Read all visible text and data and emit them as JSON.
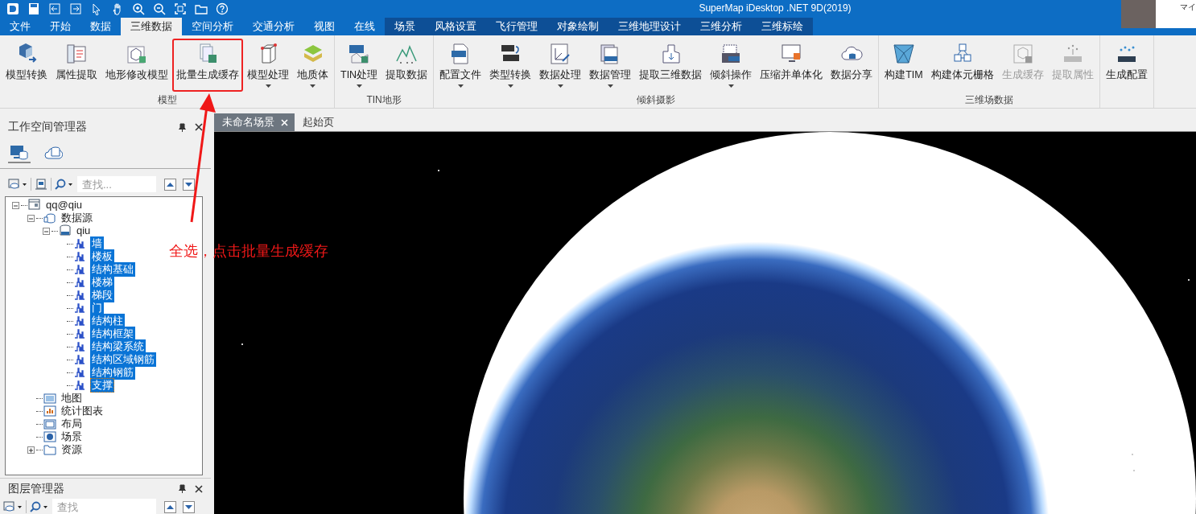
{
  "window": {
    "title": "SuperMap iDesktop .NET 9D(2019)",
    "user_label": "マイ"
  },
  "menu_tabs": [
    {
      "label": "文件",
      "selected": false,
      "kind": "main"
    },
    {
      "label": "开始",
      "selected": false,
      "kind": "main"
    },
    {
      "label": "数据",
      "selected": false,
      "kind": "main"
    },
    {
      "label": "三维数据",
      "selected": true,
      "kind": "main"
    },
    {
      "label": "空间分析",
      "selected": false,
      "kind": "main"
    },
    {
      "label": "交通分析",
      "selected": false,
      "kind": "main"
    },
    {
      "label": "视图",
      "selected": false,
      "kind": "main"
    },
    {
      "label": "在线",
      "selected": false,
      "kind": "main"
    },
    {
      "label": "场景",
      "selected": false,
      "kind": "context"
    },
    {
      "label": "风格设置",
      "selected": false,
      "kind": "context"
    },
    {
      "label": "飞行管理",
      "selected": false,
      "kind": "context"
    },
    {
      "label": "对象绘制",
      "selected": false,
      "kind": "context"
    },
    {
      "label": "三维地理设计",
      "selected": false,
      "kind": "context"
    },
    {
      "label": "三维分析",
      "selected": false,
      "kind": "context"
    },
    {
      "label": "三维标绘",
      "selected": false,
      "kind": "context"
    }
  ],
  "ribbon": {
    "groups": [
      {
        "label": "模型",
        "buttons": [
          {
            "label": "模型转换",
            "dropdown": false,
            "disabled": false,
            "highlighted": false
          },
          {
            "label": "属性提取",
            "dropdown": false,
            "disabled": false,
            "highlighted": false
          },
          {
            "label": "地形修改模型",
            "dropdown": false,
            "disabled": false,
            "highlighted": false
          },
          {
            "label": "批量生成缓存",
            "dropdown": false,
            "disabled": false,
            "highlighted": true
          },
          {
            "label": "模型处理",
            "dropdown": true,
            "disabled": false,
            "highlighted": false
          },
          {
            "label": "地质体",
            "dropdown": true,
            "disabled": false,
            "highlighted": false
          }
        ]
      },
      {
        "label": "TIN地形",
        "buttons": [
          {
            "label": "TIN处理",
            "dropdown": true,
            "disabled": false,
            "highlighted": false
          },
          {
            "label": "提取数据",
            "dropdown": false,
            "disabled": false,
            "highlighted": false
          }
        ]
      },
      {
        "label": "倾斜摄影",
        "buttons": [
          {
            "label": "配置文件",
            "dropdown": true,
            "disabled": false,
            "highlighted": false
          },
          {
            "label": "类型转换",
            "dropdown": true,
            "disabled": false,
            "highlighted": false
          },
          {
            "label": "数据处理",
            "dropdown": true,
            "disabled": false,
            "highlighted": false
          },
          {
            "label": "数据管理",
            "dropdown": true,
            "disabled": false,
            "highlighted": false
          },
          {
            "label": "提取三维数据",
            "dropdown": false,
            "disabled": false,
            "highlighted": false
          },
          {
            "label": "倾斜操作",
            "dropdown": true,
            "disabled": false,
            "highlighted": false
          },
          {
            "label": "压缩并单体化",
            "dropdown": false,
            "disabled": false,
            "highlighted": false
          },
          {
            "label": "数据分享",
            "dropdown": false,
            "disabled": false,
            "highlighted": false
          }
        ]
      },
      {
        "label": "三维场数据",
        "buttons": [
          {
            "label": "构建TIM",
            "dropdown": false,
            "disabled": false,
            "highlighted": false
          },
          {
            "label": "构建体元栅格",
            "dropdown": false,
            "disabled": false,
            "highlighted": false
          },
          {
            "label": "生成缓存",
            "dropdown": false,
            "disabled": true,
            "highlighted": false
          },
          {
            "label": "提取属性",
            "dropdown": false,
            "disabled": true,
            "highlighted": false
          }
        ]
      },
      {
        "buttons": [
          {
            "label": "生成配置",
            "dropdown": false,
            "disabled": false,
            "highlighted": false
          }
        ]
      }
    ]
  },
  "workspace_panel": {
    "title": "工作空间管理器",
    "view_tabs": [
      {
        "selected": true
      },
      {
        "selected": false
      }
    ],
    "search": {
      "placeholder": "查找..."
    },
    "tree": [
      {
        "label": "qq@qiu",
        "kind": "workspace",
        "expanded": true,
        "selected": false,
        "focused": false,
        "children": [
          {
            "label": "数据源",
            "kind": "datasources",
            "expanded": true,
            "selected": false,
            "focused": false,
            "children": [
              {
                "label": "qiu",
                "kind": "datasource",
                "expanded": true,
                "selected": false,
                "focused": false,
                "children": [
                  {
                    "label": "墙",
                    "kind": "dataset",
                    "selected": true,
                    "focused": false
                  },
                  {
                    "label": "楼板",
                    "kind": "dataset",
                    "selected": true,
                    "focused": false
                  },
                  {
                    "label": "结构基础",
                    "kind": "dataset",
                    "selected": true,
                    "focused": false
                  },
                  {
                    "label": "楼梯",
                    "kind": "dataset",
                    "selected": true,
                    "focused": false
                  },
                  {
                    "label": "梯段",
                    "kind": "dataset",
                    "selected": true,
                    "focused": false
                  },
                  {
                    "label": "门",
                    "kind": "dataset",
                    "selected": true,
                    "focused": false
                  },
                  {
                    "label": "结构柱",
                    "kind": "dataset",
                    "selected": true,
                    "focused": false
                  },
                  {
                    "label": "结构框架",
                    "kind": "dataset",
                    "selected": true,
                    "focused": false
                  },
                  {
                    "label": "结构梁系统",
                    "kind": "dataset",
                    "selected": true,
                    "focused": false
                  },
                  {
                    "label": "结构区域钢筋",
                    "kind": "dataset",
                    "selected": true,
                    "focused": false
                  },
                  {
                    "label": "结构钢筋",
                    "kind": "dataset",
                    "selected": true,
                    "focused": false
                  },
                  {
                    "label": "支撑",
                    "kind": "dataset",
                    "selected": true,
                    "focused": true
                  }
                ]
              }
            ]
          },
          {
            "label": "地图",
            "kind": "maps",
            "selected": false,
            "focused": false
          },
          {
            "label": "统计图表",
            "kind": "charts",
            "selected": false,
            "focused": false
          },
          {
            "label": "布局",
            "kind": "layouts",
            "selected": false,
            "focused": false
          },
          {
            "label": "场景",
            "kind": "scenes",
            "selected": false,
            "focused": false
          },
          {
            "label": "资源",
            "kind": "resources",
            "expanded": false,
            "selected": false,
            "focused": false
          }
        ]
      }
    ]
  },
  "layer_panel": {
    "title": "图层管理器",
    "search": {
      "placeholder": "查找"
    }
  },
  "document_tabs": [
    {
      "label": "未命名场景",
      "selected": true,
      "closable": true
    },
    {
      "label": "起始页",
      "selected": false,
      "closable": false
    }
  ],
  "annotation": {
    "text": "全选，点击批量生成缓存"
  }
}
